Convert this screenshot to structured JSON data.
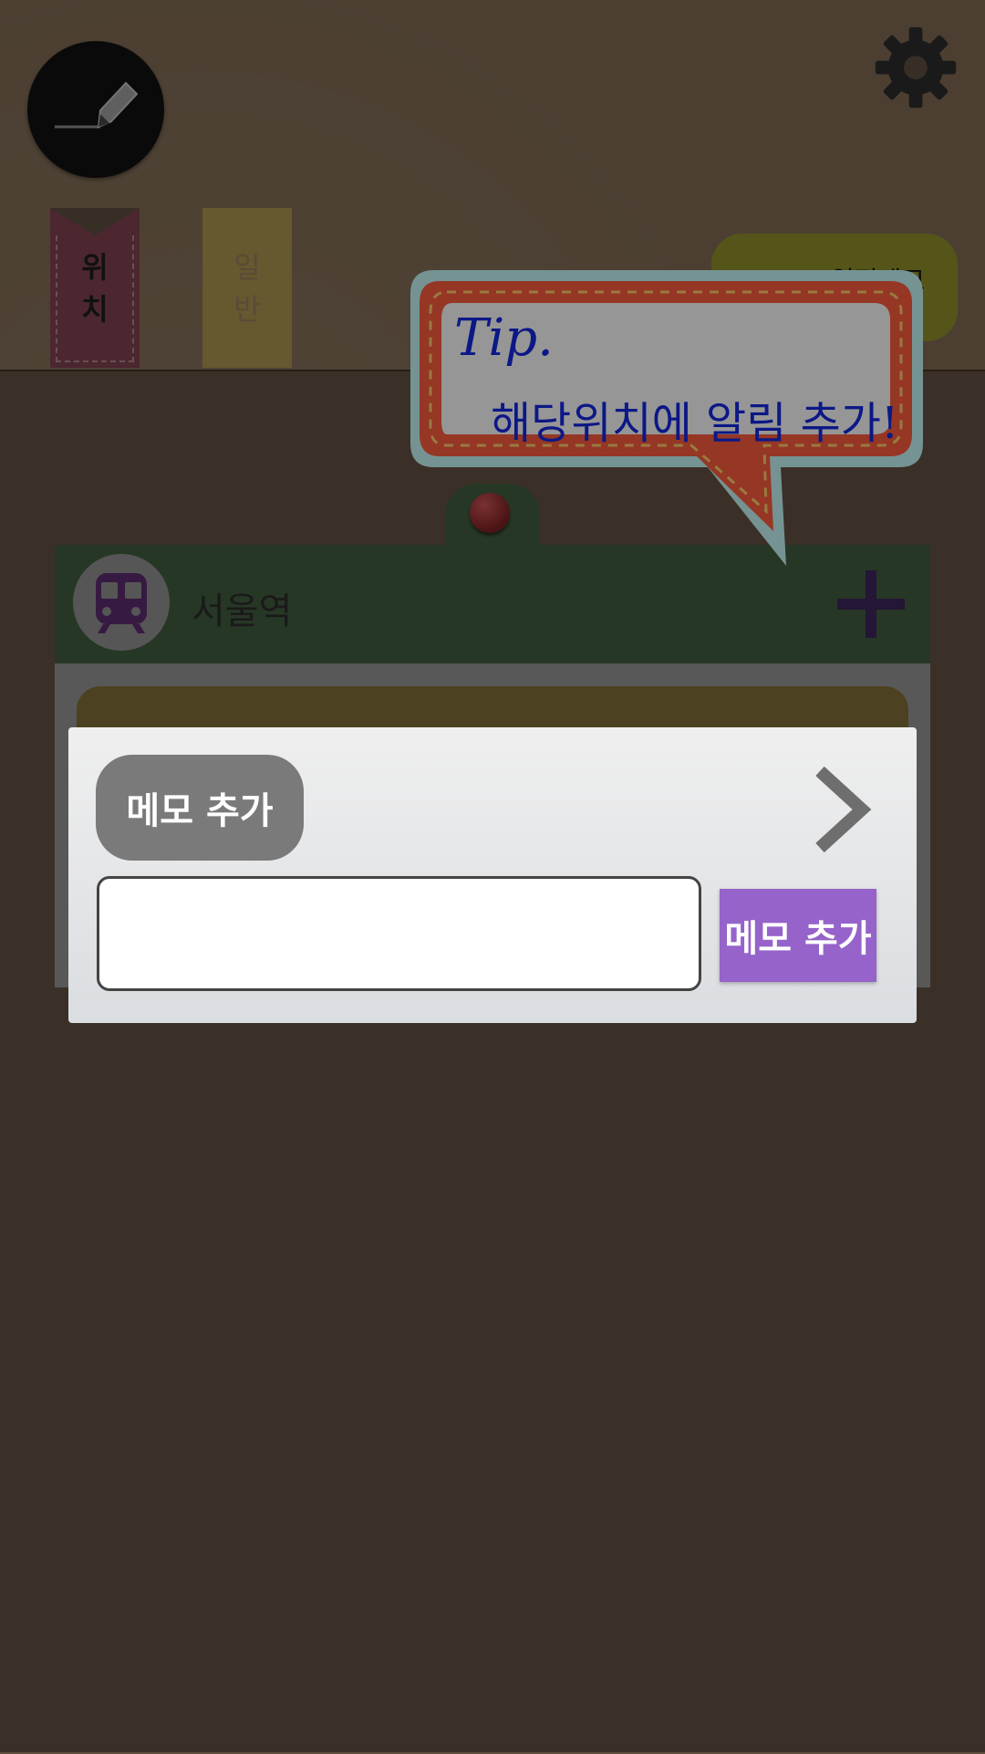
{
  "header": {
    "write_icon": "pencil-icon",
    "settings_icon": "gear-icon"
  },
  "tabs": [
    {
      "label_line1": "위",
      "label_line2": "치",
      "color": "#7b3f4c"
    },
    {
      "label_line1": "일",
      "label_line2": "반",
      "color": "#a58f4c"
    }
  ],
  "top_right_pill": {
    "label": "일정메모",
    "color": "#8a8a2a"
  },
  "tip": {
    "title": "Tip.",
    "body": "해당위치에 알림 추가!"
  },
  "location_card": {
    "icon": "subway-train-icon",
    "name": "서울역",
    "add_icon": "plus-icon",
    "accent": "#3f5a3c"
  },
  "dialog": {
    "title": "메모 추가",
    "next_icon": "chevron-right-icon",
    "input_value": "",
    "input_placeholder": "",
    "add_button_label": "메모 추가",
    "add_button_color": "#9563c9"
  }
}
